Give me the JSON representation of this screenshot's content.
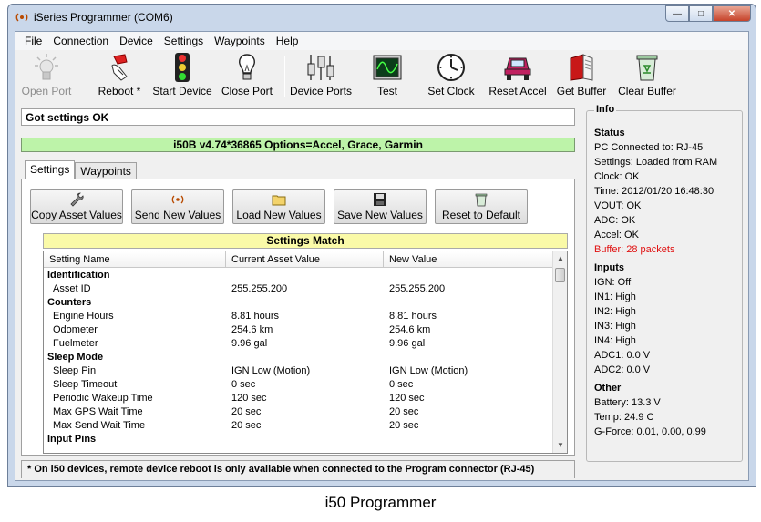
{
  "window": {
    "title": "iSeries Programmer (COM6)"
  },
  "menu": [
    {
      "accel": "F",
      "rest": "ile"
    },
    {
      "accel": "C",
      "rest": "onnection"
    },
    {
      "accel": "D",
      "rest": "evice"
    },
    {
      "accel": "S",
      "rest": "ettings"
    },
    {
      "accel": "W",
      "rest": "aypoints"
    },
    {
      "accel": "H",
      "rest": "elp"
    }
  ],
  "toolbar": {
    "open_port": "Open Port",
    "reboot": "Reboot *",
    "start_device": "Start Device",
    "close_port": "Close Port",
    "device_ports": "Device Ports",
    "test": "Test",
    "set_clock": "Set Clock",
    "reset_accel": "Reset Accel",
    "get_buffer": "Get Buffer",
    "clear_buffer": "Clear Buffer"
  },
  "status_line": "Got settings OK",
  "version_bar": "i50B v4.74*36865 Options=Accel, Grace, Garmin",
  "tabs": {
    "settings": "Settings",
    "waypoints": "Waypoints"
  },
  "actions": {
    "copy_asset": "Copy Asset Values",
    "send_new": "Send New Values",
    "load_new": "Load New Values",
    "save_new": "Save New Values",
    "reset_default": "Reset to Default"
  },
  "match_bar": "Settings Match",
  "grid": {
    "headers": [
      "Setting Name",
      "Current Asset Value",
      "New Value"
    ],
    "rows": [
      {
        "group": true,
        "name": "Identification",
        "current": "",
        "new": ""
      },
      {
        "group": false,
        "name": "Asset ID",
        "current": "255.255.200",
        "new": "255.255.200"
      },
      {
        "group": true,
        "name": "Counters",
        "current": "",
        "new": ""
      },
      {
        "group": false,
        "name": "Engine Hours",
        "current": "8.81 hours",
        "new": "8.81 hours"
      },
      {
        "group": false,
        "name": "Odometer",
        "current": "254.6 km",
        "new": "254.6 km"
      },
      {
        "group": false,
        "name": "Fuelmeter",
        "current": "9.96 gal",
        "new": "9.96 gal"
      },
      {
        "group": true,
        "name": "Sleep Mode",
        "current": "",
        "new": ""
      },
      {
        "group": false,
        "name": "Sleep Pin",
        "current": "IGN Low (Motion)",
        "new": "IGN Low (Motion)"
      },
      {
        "group": false,
        "name": "Sleep Timeout",
        "current": "0 sec",
        "new": "0 sec"
      },
      {
        "group": false,
        "name": "Periodic Wakeup Time",
        "current": "120 sec",
        "new": "120 sec"
      },
      {
        "group": false,
        "name": "Max GPS Wait Time",
        "current": "20 sec",
        "new": "20 sec"
      },
      {
        "group": false,
        "name": "Max Send Wait Time",
        "current": "20 sec",
        "new": "20 sec"
      },
      {
        "group": true,
        "name": "Input Pins",
        "current": "",
        "new": ""
      }
    ]
  },
  "footer": "* On i50 devices, remote device reboot is only available when connected to the Program connector (RJ-45)",
  "info": {
    "legend": "Info",
    "status": {
      "title": "Status",
      "lines": [
        {
          "text": "PC Connected to: RJ-45",
          "alert": false
        },
        {
          "text": "Settings: Loaded from RAM",
          "alert": false
        },
        {
          "text": "Clock: OK",
          "alert": false
        },
        {
          "text": "Time: 2012/01/20 16:48:30",
          "alert": false
        },
        {
          "text": "VOUT: OK",
          "alert": false
        },
        {
          "text": "ADC: OK",
          "alert": false
        },
        {
          "text": "Accel: OK",
          "alert": false
        },
        {
          "text": "Buffer: 28 packets",
          "alert": true
        }
      ]
    },
    "inputs": {
      "title": "Inputs",
      "lines": [
        "IGN: Off",
        "IN1: High",
        "IN2: High",
        "IN3: High",
        "IN4: High",
        "ADC1: 0.0 V",
        "ADC2: 0.0 V"
      ]
    },
    "other": {
      "title": "Other",
      "lines": [
        "Battery: 13.3 V",
        "Temp: 24.9 C",
        "G-Force: 0.01, 0.00, 0.99"
      ]
    }
  },
  "caption": "i50 Programmer",
  "colors": {
    "version_bar": "#bdf3a9",
    "match_bar": "#fafaa8",
    "alert": "#e01010"
  }
}
